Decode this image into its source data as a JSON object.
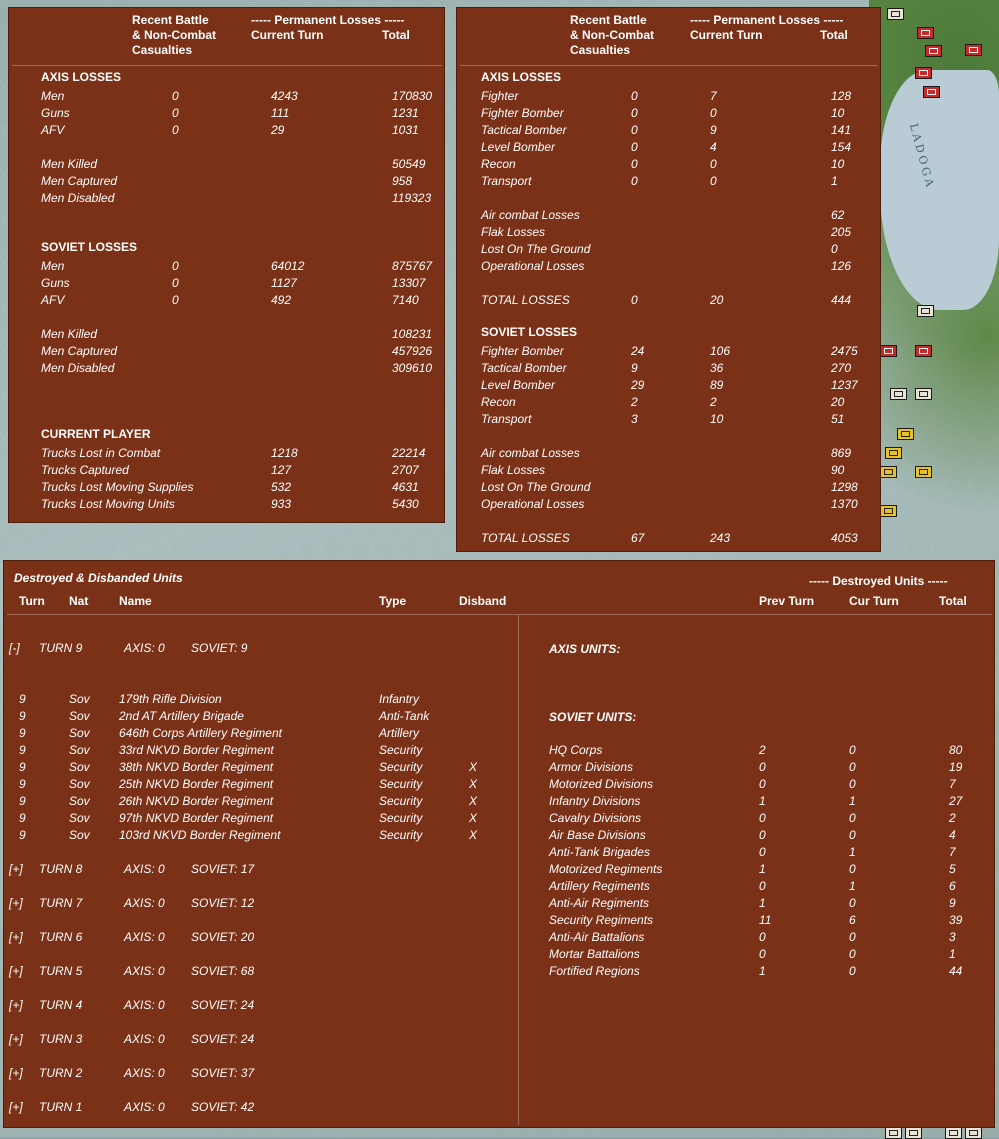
{
  "ground": {
    "header": {
      "l1": "Recent Battle",
      "l2": "& Non-Combat",
      "l3": "Casualties",
      "perm": "----- Permanent Losses -----",
      "cur": "Current Turn",
      "tot": "Total"
    },
    "axis_title": "AXIS LOSSES",
    "axis_rows": [
      {
        "label": "Men",
        "recent": "0",
        "current": "4243",
        "total": "170830"
      },
      {
        "label": "Guns",
        "recent": "0",
        "current": "111",
        "total": "1231"
      },
      {
        "label": "AFV",
        "recent": "0",
        "current": "29",
        "total": "1031"
      }
    ],
    "axis_detail": [
      {
        "label": "Men Killed",
        "total": "50549"
      },
      {
        "label": "Men Captured",
        "total": "958"
      },
      {
        "label": "Men Disabled",
        "total": "119323"
      }
    ],
    "soviet_title": "SOVIET LOSSES",
    "soviet_rows": [
      {
        "label": "Men",
        "recent": "0",
        "current": "64012",
        "total": "875767"
      },
      {
        "label": "Guns",
        "recent": "0",
        "current": "1127",
        "total": "13307"
      },
      {
        "label": "AFV",
        "recent": "0",
        "current": "492",
        "total": "7140"
      }
    ],
    "soviet_detail": [
      {
        "label": "Men Killed",
        "total": "108231"
      },
      {
        "label": "Men Captured",
        "total": "457926"
      },
      {
        "label": "Men Disabled",
        "total": "309610"
      }
    ],
    "player_title": "CURRENT PLAYER",
    "player_rows": [
      {
        "label": "Trucks Lost in Combat",
        "current": "1218",
        "total": "22214"
      },
      {
        "label": "Trucks Captured",
        "current": "127",
        "total": "2707"
      },
      {
        "label": "Trucks Lost Moving Supplies",
        "current": "532",
        "total": "4631"
      },
      {
        "label": "Trucks Lost Moving Units",
        "current": "933",
        "total": "5430"
      }
    ]
  },
  "air": {
    "header": {
      "l1": "Recent Battle",
      "l2": "& Non-Combat",
      "l3": "Casualties",
      "perm": "----- Permanent Losses -----",
      "cur": "Current Turn",
      "tot": "Total"
    },
    "axis_title": "AXIS LOSSES",
    "axis_rows": [
      {
        "label": "Fighter",
        "recent": "0",
        "current": "7",
        "total": "128"
      },
      {
        "label": "Fighter Bomber",
        "recent": "0",
        "current": "0",
        "total": "10"
      },
      {
        "label": "Tactical Bomber",
        "recent": "0",
        "current": "9",
        "total": "141"
      },
      {
        "label": "Level Bomber",
        "recent": "0",
        "current": "4",
        "total": "154"
      },
      {
        "label": "Recon",
        "recent": "0",
        "current": "0",
        "total": "10"
      },
      {
        "label": "Transport",
        "recent": "0",
        "current": "0",
        "total": "1"
      }
    ],
    "axis_detail": [
      {
        "label": "Air combat Losses",
        "total": "62"
      },
      {
        "label": "Flak Losses",
        "total": "205"
      },
      {
        "label": "Lost On The Ground",
        "total": "0"
      },
      {
        "label": "Operational Losses",
        "total": "126"
      }
    ],
    "axis_total": {
      "label": "TOTAL LOSSES",
      "recent": "0",
      "current": "20",
      "total": "444"
    },
    "soviet_title": "SOVIET LOSSES",
    "soviet_rows": [
      {
        "label": "Fighter Bomber",
        "recent": "24",
        "current": "106",
        "total": "2475"
      },
      {
        "label": "Tactical Bomber",
        "recent": "9",
        "current": "36",
        "total": "270"
      },
      {
        "label": "Level Bomber",
        "recent": "29",
        "current": "89",
        "total": "1237"
      },
      {
        "label": "Recon",
        "recent": "2",
        "current": "2",
        "total": "20"
      },
      {
        "label": "Transport",
        "recent": "3",
        "current": "10",
        "total": "51"
      }
    ],
    "soviet_detail": [
      {
        "label": "Air combat Losses",
        "total": "869"
      },
      {
        "label": "Flak Losses",
        "total": "90"
      },
      {
        "label": "Lost On The Ground",
        "total": "1298"
      },
      {
        "label": "Operational Losses",
        "total": "1370"
      }
    ],
    "soviet_total": {
      "label": "TOTAL LOSSES",
      "recent": "67",
      "current": "243",
      "total": "4053"
    }
  },
  "destroyed": {
    "title": "Destroyed & Disbanded Units",
    "dest_header": "----- Destroyed Units -----",
    "cols": {
      "turn": "Turn",
      "nat": "Nat",
      "name": "Name",
      "type": "Type",
      "disband": "Disband",
      "prev": "Prev Turn",
      "cur": "Cur Turn",
      "total": "Total"
    },
    "expanded": {
      "toggle": "[-]",
      "turn": "TURN 9",
      "axis": "AXIS: 0",
      "soviet": "SOVIET: 9"
    },
    "units": [
      {
        "turn": "9",
        "nat": "Sov",
        "name": "179th Rifle Division",
        "type": "Infantry",
        "disband": ""
      },
      {
        "turn": "9",
        "nat": "Sov",
        "name": "2nd AT Artillery Brigade",
        "type": "Anti-Tank",
        "disband": ""
      },
      {
        "turn": "9",
        "nat": "Sov",
        "name": "646th Corps Artillery Regiment",
        "type": "Artillery",
        "disband": ""
      },
      {
        "turn": "9",
        "nat": "Sov",
        "name": "33rd NKVD Border Regiment",
        "type": "Security",
        "disband": ""
      },
      {
        "turn": "9",
        "nat": "Sov",
        "name": "38th NKVD Border Regiment",
        "type": "Security",
        "disband": "X"
      },
      {
        "turn": "9",
        "nat": "Sov",
        "name": "25th NKVD Border Regiment",
        "type": "Security",
        "disband": "X"
      },
      {
        "turn": "9",
        "nat": "Sov",
        "name": "26th NKVD Border Regiment",
        "type": "Security",
        "disband": "X"
      },
      {
        "turn": "9",
        "nat": "Sov",
        "name": "97th NKVD Border Regiment",
        "type": "Security",
        "disband": "X"
      },
      {
        "turn": "9",
        "nat": "Sov",
        "name": "103rd NKVD Border Regiment",
        "type": "Security",
        "disband": "X"
      }
    ],
    "collapsed": [
      {
        "toggle": "[+]",
        "turn": "TURN 8",
        "axis": "AXIS: 0",
        "soviet": "SOVIET: 17"
      },
      {
        "toggle": "[+]",
        "turn": "TURN 7",
        "axis": "AXIS: 0",
        "soviet": "SOVIET: 12"
      },
      {
        "toggle": "[+]",
        "turn": "TURN 6",
        "axis": "AXIS: 0",
        "soviet": "SOVIET: 20"
      },
      {
        "toggle": "[+]",
        "turn": "TURN 5",
        "axis": "AXIS: 0",
        "soviet": "SOVIET: 68"
      },
      {
        "toggle": "[+]",
        "turn": "TURN 4",
        "axis": "AXIS: 0",
        "soviet": "SOVIET: 24"
      },
      {
        "toggle": "[+]",
        "turn": "TURN 3",
        "axis": "AXIS: 0",
        "soviet": "SOVIET: 24"
      },
      {
        "toggle": "[+]",
        "turn": "TURN 2",
        "axis": "AXIS: 0",
        "soviet": "SOVIET: 37"
      },
      {
        "toggle": "[+]",
        "turn": "TURN 1",
        "axis": "AXIS: 0",
        "soviet": "SOVIET: 42"
      }
    ],
    "axis_units_title": "AXIS UNITS:",
    "soviet_units_title": "SOVIET UNITS:",
    "soviet_units": [
      {
        "label": "HQ Corps",
        "prev": "2",
        "cur": "0",
        "total": "80"
      },
      {
        "label": "Armor Divisions",
        "prev": "0",
        "cur": "0",
        "total": "19"
      },
      {
        "label": "Motorized Divisions",
        "prev": "0",
        "cur": "0",
        "total": "7"
      },
      {
        "label": "Infantry Divisions",
        "prev": "1",
        "cur": "1",
        "total": "27"
      },
      {
        "label": "Cavalry Divisions",
        "prev": "0",
        "cur": "0",
        "total": "2"
      },
      {
        "label": "Air Base Divisions",
        "prev": "0",
        "cur": "0",
        "total": "4"
      },
      {
        "label": "Anti-Tank Brigades",
        "prev": "0",
        "cur": "1",
        "total": "7"
      },
      {
        "label": "Motorized Regiments",
        "prev": "1",
        "cur": "0",
        "total": "5"
      },
      {
        "label": "Artillery Regiments",
        "prev": "0",
        "cur": "1",
        "total": "6"
      },
      {
        "label": "Anti-Air Regiments",
        "prev": "1",
        "cur": "0",
        "total": "9"
      },
      {
        "label": "Security Regiments",
        "prev": "11",
        "cur": "6",
        "total": "39"
      },
      {
        "label": "Anti-Air Battalions",
        "prev": "0",
        "cur": "0",
        "total": "3"
      },
      {
        "label": "Mortar Battalions",
        "prev": "0",
        "cur": "0",
        "total": "1"
      },
      {
        "label": "Fortified Regions",
        "prev": "1",
        "cur": "0",
        "total": "44"
      }
    ]
  },
  "map": {
    "lake_label": "LADOGA"
  }
}
